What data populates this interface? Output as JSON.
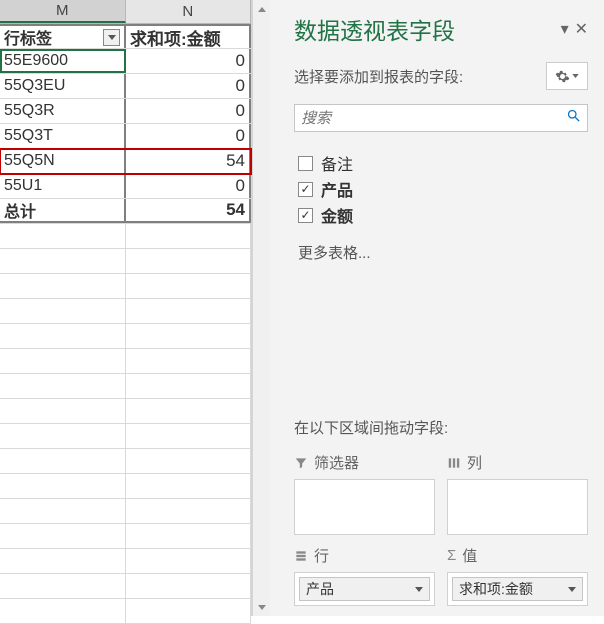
{
  "columns": {
    "m": "M",
    "n": "N"
  },
  "headers": {
    "row_label": "行标签",
    "sum_amount": "求和项:金额"
  },
  "rows": [
    {
      "label": "55E9600",
      "value": "0"
    },
    {
      "label": "55Q3EU",
      "value": "0"
    },
    {
      "label": "55Q3R",
      "value": "0"
    },
    {
      "label": "55Q3T",
      "value": "0"
    },
    {
      "label": "55Q5N",
      "value": "54"
    },
    {
      "label": "55U1",
      "value": "0"
    }
  ],
  "total": {
    "label": "总计",
    "value": "54"
  },
  "panel": {
    "title": "数据透视表字段",
    "subtitle": "选择要添加到报表的字段:",
    "search_placeholder": "搜索",
    "more_tables": "更多表格...",
    "areas_label": "在以下区域间拖动字段:"
  },
  "fields": [
    {
      "label": "备注",
      "checked": false,
      "bold": false
    },
    {
      "label": "产品",
      "checked": true,
      "bold": true
    },
    {
      "label": "金额",
      "checked": true,
      "bold": true
    }
  ],
  "areas": {
    "filter": {
      "title": "筛选器"
    },
    "columns": {
      "title": "列"
    },
    "rows": {
      "title": "行",
      "chip": "产品"
    },
    "values": {
      "title": "值",
      "chip": "求和项:金额"
    }
  }
}
